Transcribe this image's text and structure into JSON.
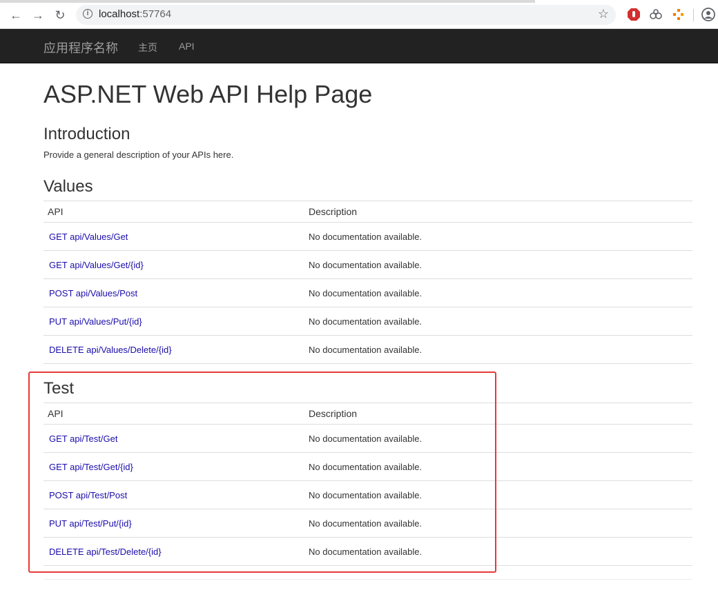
{
  "browser": {
    "url_host": "localhost",
    "url_port": ":57764",
    "icons": [
      "back-icon",
      "forward-icon",
      "reload-icon",
      "info-icon",
      "star-icon",
      "adblock-icon",
      "extension-icon",
      "extension-orange-icon",
      "profile-icon"
    ]
  },
  "navbar": {
    "brand": "应用程序名称",
    "links": [
      "主页",
      "API"
    ]
  },
  "page": {
    "title": "ASP.NET Web API Help Page",
    "intro_title": "Introduction",
    "intro_text": "Provide a general description of your APIs here."
  },
  "sections": [
    {
      "title": "Values",
      "headers": [
        "API",
        "Description"
      ],
      "rows": [
        {
          "api": "GET api/Values/Get",
          "desc": "No documentation available."
        },
        {
          "api": "GET api/Values/Get/{id}",
          "desc": "No documentation available."
        },
        {
          "api": "POST api/Values/Post",
          "desc": "No documentation available."
        },
        {
          "api": "PUT api/Values/Put/{id}",
          "desc": "No documentation available."
        },
        {
          "api": "DELETE api/Values/Delete/{id}",
          "desc": "No documentation available."
        }
      ]
    },
    {
      "title": "Test",
      "headers": [
        "API",
        "Description"
      ],
      "rows": [
        {
          "api": "GET api/Test/Get",
          "desc": "No documentation available."
        },
        {
          "api": "GET api/Test/Get/{id}",
          "desc": "No documentation available."
        },
        {
          "api": "POST api/Test/Post",
          "desc": "No documentation available."
        },
        {
          "api": "PUT api/Test/Put/{id}",
          "desc": "No documentation available."
        },
        {
          "api": "DELETE api/Test/Delete/{id}",
          "desc": "No documentation available."
        }
      ]
    }
  ],
  "colors": {
    "navbar_bg": "#222222",
    "link": "#1a0dab",
    "highlight_border": "#e53935"
  }
}
